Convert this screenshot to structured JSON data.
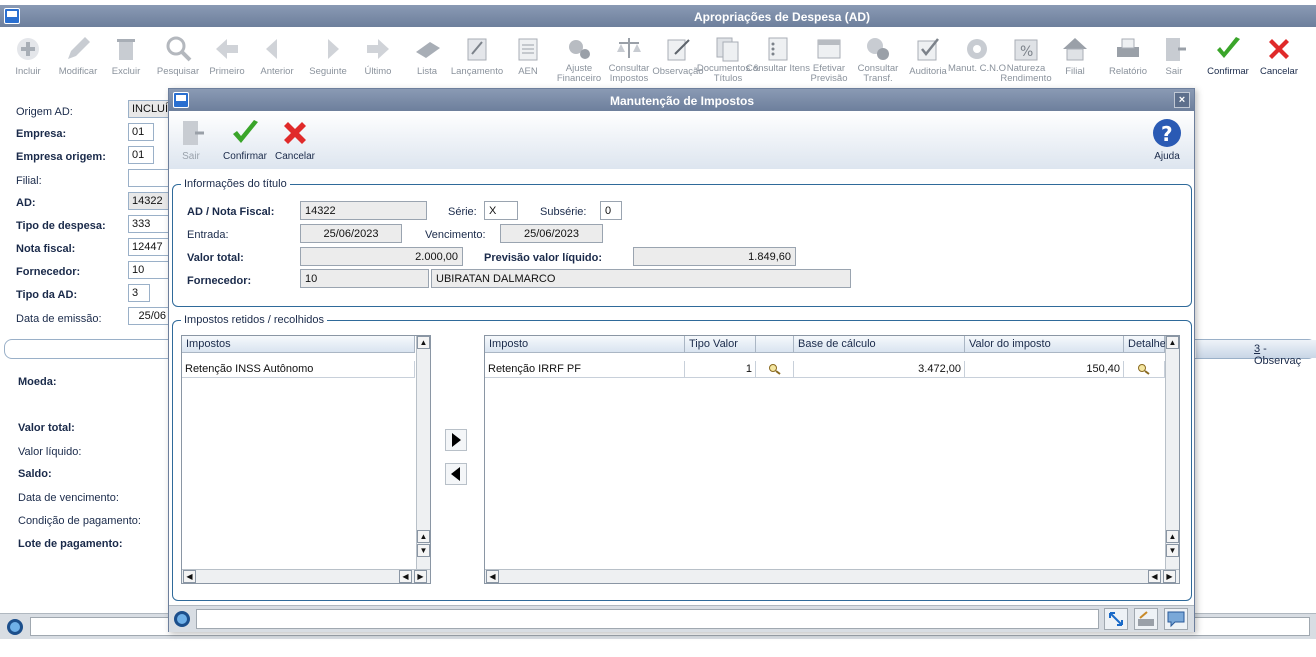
{
  "main": {
    "title": "Apropriações de Despesa (AD)",
    "toolbar": [
      {
        "label": "Incluir",
        "icon": "add-icon"
      },
      {
        "label": "Modificar",
        "icon": "edit-icon"
      },
      {
        "label": "Excluir",
        "icon": "delete-icon"
      },
      {
        "label": "Pesquisar",
        "icon": "search-icon"
      },
      {
        "label": "Primeiro",
        "icon": "first-icon"
      },
      {
        "label": "Anterior",
        "icon": "previous-icon"
      },
      {
        "label": "Seguinte",
        "icon": "next-icon"
      },
      {
        "label": "Último",
        "icon": "last-icon"
      },
      {
        "label": "Lista",
        "icon": "list-icon"
      },
      {
        "label": "Lançamento",
        "icon": "entry-icon"
      },
      {
        "label": "AEN",
        "icon": "aen-icon"
      },
      {
        "label": "Ajuste Financeiro",
        "icon": "financial-adjust-icon"
      },
      {
        "label": "Consultar Impostos",
        "icon": "taxes-icon"
      },
      {
        "label": "Observação",
        "icon": "note-icon"
      },
      {
        "label": "Documentos & Títulos",
        "icon": "documents-icon"
      },
      {
        "label": "Consultar Itens",
        "icon": "items-icon"
      },
      {
        "label": "Efetivar Previsão",
        "icon": "forecast-icon"
      },
      {
        "label": "Consultar Transf.",
        "icon": "transfer-icon"
      },
      {
        "label": "Auditoria",
        "icon": "audit-icon"
      },
      {
        "label": "Manut. C.N.O",
        "icon": "cno-icon"
      },
      {
        "label": "Natureza Rendimento",
        "icon": "income-nature-icon"
      },
      {
        "label": "Filial",
        "icon": "branch-icon"
      },
      {
        "label": "Relatório",
        "icon": "print-icon"
      },
      {
        "label": "Sair",
        "icon": "exit-icon"
      },
      {
        "label": "Confirmar",
        "icon": "confirm-icon"
      },
      {
        "label": "Cancelar",
        "icon": "cancel-icon"
      }
    ],
    "form": {
      "origem_ad_label": "Origem AD:",
      "origem_ad_value": "INCLUÍD",
      "empresa_label": "Empresa:",
      "empresa_value": "01",
      "empresa_origem_label": "Empresa origem:",
      "empresa_origem_value": "01",
      "filial_label": "Filial:",
      "ad_label": "AD:",
      "ad_value": "14322",
      "tipo_despesa_label": "Tipo de despesa:",
      "tipo_despesa_value": "333",
      "nota_fiscal_label": "Nota fiscal:",
      "nota_fiscal_value": "12447",
      "fornecedor_label": "Fornecedor:",
      "fornecedor_value": "10",
      "tipo_ad_label": "Tipo da AD:",
      "tipo_ad_value": "3",
      "data_emissao_label": "Data de emissão:",
      "data_emissao_value": "25/06"
    },
    "tab_right": {
      "key": "3",
      "label": " - Observaç"
    },
    "lower": {
      "moeda": "Moeda:",
      "valor_total": "Valor total:",
      "valor_liquido": "Valor líquido:",
      "saldo": "Saldo:",
      "data_vencimento": "Data de vencimento:",
      "condicao_pagamento": "Condição de pagamento:",
      "lote_pagamento": "Lote de pagamento:"
    }
  },
  "dialog": {
    "title": "Manutenção de Impostos",
    "close": "×",
    "toolbar": {
      "sair": "Sair",
      "confirmar": "Confirmar",
      "cancelar": "Cancelar",
      "ajuda": "Ajuda"
    },
    "info_group": "Informações do título",
    "ad_nf_label": "AD / Nota Fiscal:",
    "ad_nf_value": "14322",
    "serie_label": "Série:",
    "serie_value": "X",
    "subserie_label": "Subsérie:",
    "subserie_value": "0",
    "entrada_label": "Entrada:",
    "entrada_value": "25/06/2023",
    "vencimento_label": "Vencimento:",
    "vencimento_value": "25/06/2023",
    "valor_total_label": "Valor total:",
    "valor_total_value": "2.000,00",
    "previsao_label": "Previsão valor líquido:",
    "previsao_value": "1.849,60",
    "fornecedor_label": "Fornecedor:",
    "fornecedor_code": "10",
    "fornecedor_name": "UBIRATAN DALMARCO",
    "taxes_group": "Impostos retidos / recolhidos",
    "left_grid": {
      "header": "Impostos",
      "rows": [
        "Retenção INSS Autônomo"
      ]
    },
    "right_grid": {
      "headers": [
        "Imposto",
        "Tipo Valor",
        "",
        "Base de cálculo",
        "Valor do imposto",
        "Detalhe"
      ],
      "rows": [
        {
          "imposto": "Retenção IRRF PF",
          "tipo_valor": "1",
          "base": "3.472,00",
          "valor": "150,40"
        }
      ]
    }
  }
}
